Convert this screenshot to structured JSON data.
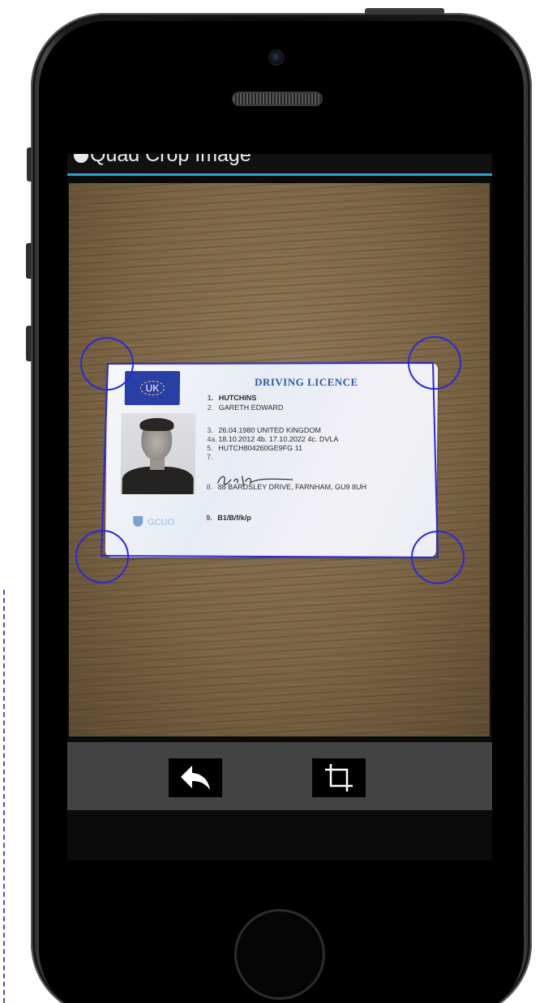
{
  "window": {
    "title": "Quad Crop Image",
    "accent_color": "#2aa0d0",
    "crop_handle_color": "#2a2ad6"
  },
  "licence": {
    "header": "DRIVING LICENCE",
    "country_badge": "UK",
    "lines": [
      {
        "num": "1.",
        "text": "HUTCHINS"
      },
      {
        "num": "2.",
        "text": "GARETH EDWARD"
      },
      {
        "num": "3.",
        "text": "26.04.1980  UNITED KINGDOM"
      },
      {
        "num": "4a.",
        "text": "18.10.2012  4b.  17.10.2022  4c.  DVLA"
      },
      {
        "num": "5.",
        "text": "HUTCH804260GE9FG  11"
      },
      {
        "num": "7.",
        "text": ""
      },
      {
        "num": "8.",
        "text": "88 BARDSLEY DRIVE, FARNHAM, GU9 8UH"
      },
      {
        "num": "9.",
        "text": "B1/B/f/k/p"
      }
    ],
    "hologram_text": "GCUO"
  },
  "toolbar": {
    "back_icon": "reply-arrow-icon",
    "crop_icon": "crop-icon"
  }
}
